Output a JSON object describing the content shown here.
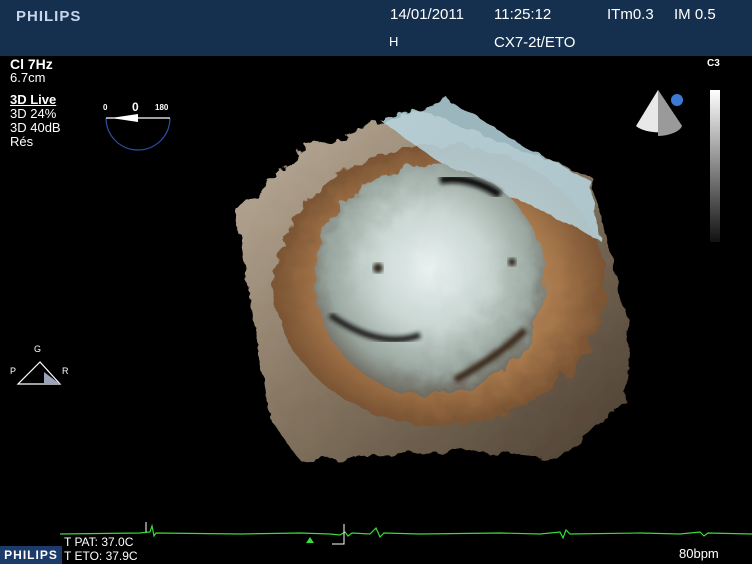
{
  "header": {
    "brand": "PHILIPS",
    "date": "14/01/2011",
    "time": "11:25:12",
    "itm": "ITm0.3",
    "im": "IM 0.5",
    "marker": "H",
    "transducer": "CX7-2t/ETO"
  },
  "left_info": {
    "line1": "Cl 7Hz",
    "line2": "6.7cm",
    "mode": "3D Live",
    "gain": "3D 24%",
    "comp": "3D 40dB",
    "res": "Rés"
  },
  "angle_gauge": {
    "min": "0",
    "value": "0",
    "max": "180"
  },
  "probe_label": "C3",
  "orientation": {
    "top": "G",
    "left": "P",
    "right": "R"
  },
  "footer": {
    "brand": "PHILIPS",
    "t_pat": "T PAT: 37.0C",
    "t_eto": "T ETO: 37.9C",
    "heart_rate": "80bpm"
  },
  "colors": {
    "header_bg": "#15304f",
    "ecg_trace": "#3adb3a",
    "probe_dot": "#3b7bd6"
  }
}
